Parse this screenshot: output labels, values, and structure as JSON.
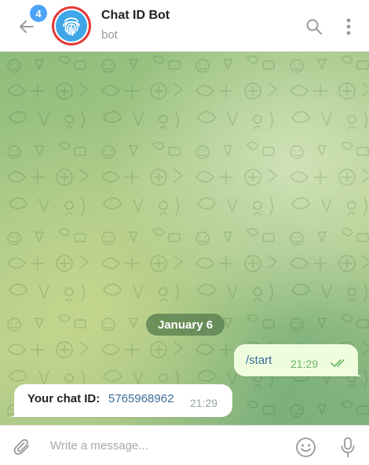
{
  "header": {
    "unread_badge": "4",
    "title": "Chat ID Bot",
    "status": "bot"
  },
  "chat": {
    "date_separator": "January 6",
    "outgoing": {
      "text": "/start",
      "time": "21:29"
    },
    "incoming": {
      "label": "Your chat ID:",
      "value": "5765968962",
      "time": "21:29"
    }
  },
  "composer": {
    "placeholder": "Write a message..."
  },
  "colors": {
    "accent": "#4ea4f6",
    "avatar_ring": "#e53935",
    "avatar_fill": "#3fa7e8",
    "outgoing_bubble": "#effdde",
    "read_check": "#6db566"
  },
  "icons": {
    "back": "arrow-left-icon",
    "avatar": "fingerprint-icon",
    "search": "search-icon",
    "menu": "more-vertical-icon",
    "read": "double-check-icon",
    "attach": "paperclip-icon",
    "emoji": "smiley-icon",
    "voice": "microphone-icon"
  }
}
